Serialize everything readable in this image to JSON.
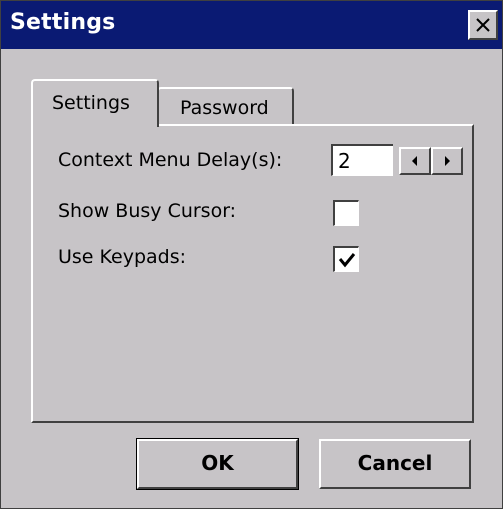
{
  "window": {
    "title": "Settings",
    "close_icon": "close-icon"
  },
  "tabs": [
    {
      "label": "Settings",
      "selected": true
    },
    {
      "label": "Password",
      "selected": false
    }
  ],
  "settings": {
    "context_menu_delay": {
      "label": "Context Menu Delay(s):",
      "value": "2"
    },
    "show_busy_cursor": {
      "label": "Show Busy Cursor:",
      "checked": false
    },
    "use_keypads": {
      "label": "Use Keypads:",
      "checked": true
    }
  },
  "buttons": {
    "ok": "OK",
    "cancel": "Cancel"
  },
  "colors": {
    "titlebar": "#0a1a73",
    "face": "#c7c4c7"
  }
}
